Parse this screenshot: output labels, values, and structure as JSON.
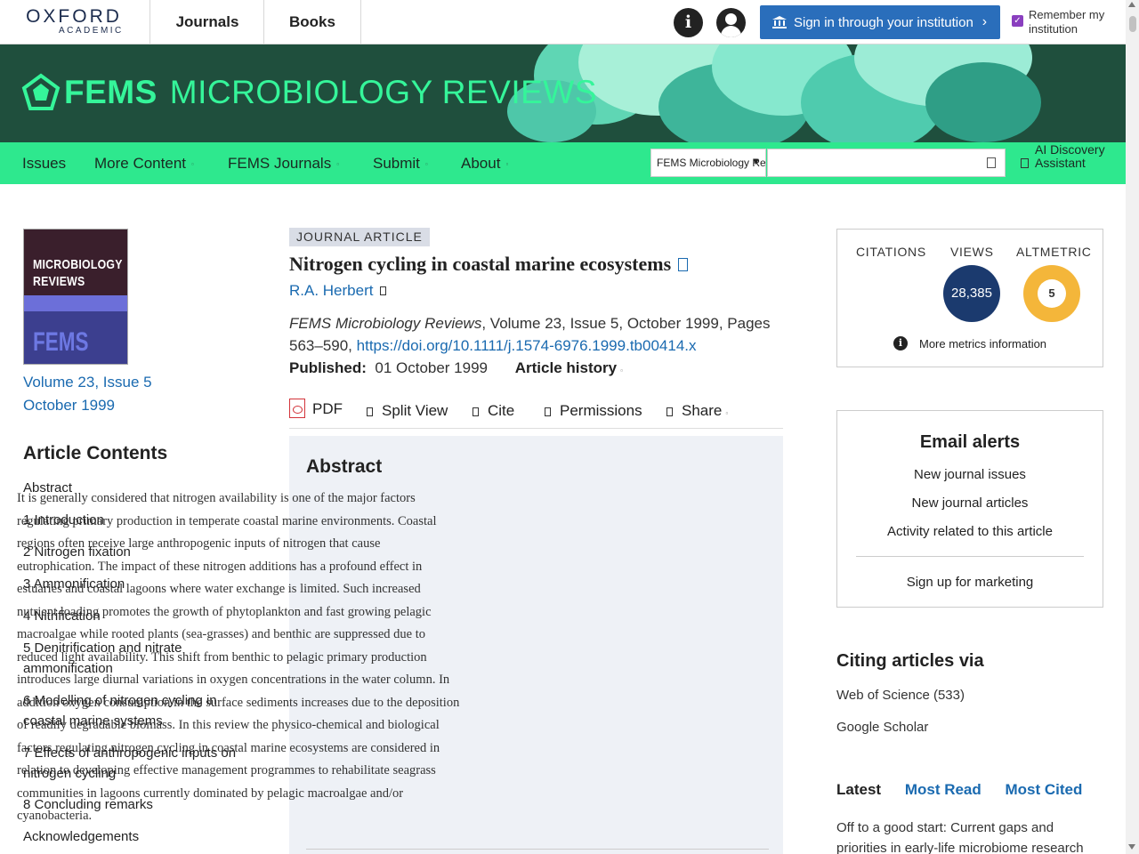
{
  "header": {
    "logo_line1": "OXFORD",
    "logo_line2": "ACADEMIC",
    "nav_journals": "Journals",
    "nav_books": "Books",
    "info_glyph": "i",
    "signin_label": "Sign in through your institution",
    "signin_chevron": "›",
    "remember_label": "Remember my institution",
    "remember_checked": true,
    "check_glyph": "✓"
  },
  "banner": {
    "title_bold": "FEMS",
    "title_rest": "MICROBIOLOGY REVIEWS"
  },
  "journal_nav": {
    "items": [
      "Issues",
      "More Content",
      "FEMS Journals",
      "Submit",
      "About"
    ],
    "search_scope": "FEMS Microbiology Reviews",
    "search_placeholder": "",
    "dropdown_glyph": "▼",
    "ai_label": "AI Discovery Assistant"
  },
  "sidebar": {
    "cover_title": "MICROBIOLOGY REVIEWS",
    "cover_brand": "FEMS",
    "volume_link": "Volume 23, Issue 5",
    "date_link": "October 1999",
    "contents_heading": "Article Contents",
    "toc": [
      "Abstract",
      "1 Introduction",
      "2 Nitrogen fixation",
      "3 Ammonification",
      "4 Nitrification",
      "5 Denitrification and nitrate ammonification",
      "6 Modelling of nitrogen cycling in coastal marine systems",
      "7 Effects of anthropogenic inputs on nitrogen cycling",
      "8 Concluding remarks",
      "Acknowledgements"
    ]
  },
  "article": {
    "type_badge": "JOURNAL ARTICLE",
    "title": "Nitrogen cycling in coastal marine ecosystems",
    "author": "R.A. Herbert",
    "journal_name": "FEMS Microbiology Reviews",
    "citation_rest": ", Volume 23, Issue 5, October 1999, Pages 563–590, ",
    "doi": "https://doi.org/10.1111/j.1574-6976.1999.tb00414.x",
    "published_label": "Published:",
    "published_date": "01 October 1999",
    "history_label": "Article history",
    "tools": [
      "PDF",
      "Split View",
      "Cite",
      "Permissions",
      "Share"
    ],
    "abstract_heading": "Abstract",
    "abstract_lines": [
      "It is generally considered that nitrogen availability is one of the major factors",
      "regulating primary production in temperate coastal marine environments. Coastal",
      "regions often receive large anthropogenic inputs of nitrogen that cause",
      "eutrophication. The impact of these nitrogen additions has a profound effect in",
      "estuaries and coastal lagoons where water exchange is limited. Such increased",
      "nutrient loading promotes the growth of phytoplankton and fast growing pelagic",
      "macroalgae while rooted plants (sea-grasses) and benthic are suppressed due to",
      "reduced light availability. This shift from benthic to pelagic primary production",
      "introduces large diurnal variations in oxygen concentrations in the water column. In",
      "addition oxygen consumption in the surface sediments increases due to the deposition",
      "of readily degradable biomass. In this review the physico-chemical and biological",
      "factors regulating nitrogen cycling in coastal marine ecosystems are considered in",
      "relation to developing effective management programmes to rehabilitate seagrass",
      "communities in lagoons currently dominated by pelagic macroalgae and/or",
      "cyanobacteria."
    ]
  },
  "metrics": {
    "citations_label": "CITATIONS",
    "views_label": "VIEWS",
    "altmetric_label": "ALTMETRIC",
    "views_value": "28,385",
    "altmetric_value": "5",
    "more_label": "More metrics information",
    "info_glyph": "i"
  },
  "email_alerts": {
    "heading": "Email alerts",
    "items": [
      "New journal issues",
      "New journal articles",
      "Activity related to this article"
    ],
    "marketing": "Sign up for marketing"
  },
  "citing": {
    "heading": "Citing articles via",
    "items": [
      "Web of Science (533)",
      "Google Scholar"
    ]
  },
  "latest": {
    "tabs": [
      "Latest",
      "Most Read",
      "Most Cited"
    ],
    "first_article": "Off to a good start: Current gaps and priorities in early-life microbiome research"
  },
  "colors": {
    "brand_green": "#2ee88e",
    "banner_dark": "#1f4f3d",
    "link_blue": "#1a6ab0",
    "signin_blue": "#2a6ebb",
    "views_navy": "#1b3a6e",
    "altmetric_gold": "#f4b63a"
  }
}
